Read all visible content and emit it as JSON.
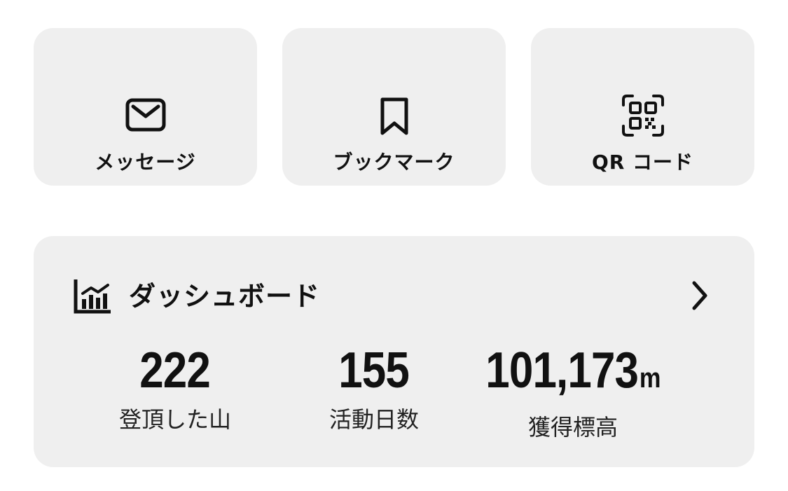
{
  "quick_actions": {
    "messages": {
      "label": "メッセージ",
      "icon": "envelope-icon"
    },
    "bookmarks": {
      "label": "ブックマーク",
      "icon": "bookmark-icon"
    },
    "qr": {
      "label": "QR コード",
      "icon": "qr-code-icon"
    }
  },
  "dashboard": {
    "title": "ダッシュボード",
    "icon": "bar-chart-icon",
    "chevron": "chevron-right-icon",
    "stats": [
      {
        "value": "222",
        "unit": "",
        "label": "登頂した山"
      },
      {
        "value": "155",
        "unit": "",
        "label": "活動日数"
      },
      {
        "value": "101,173",
        "unit": "m",
        "label": "獲得標高"
      }
    ]
  },
  "colors": {
    "background": "#ffffff",
    "card": "#efefef",
    "text": "#111111"
  }
}
